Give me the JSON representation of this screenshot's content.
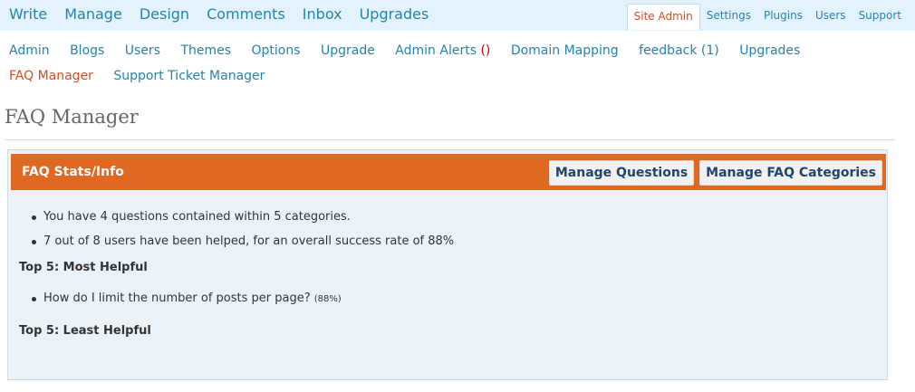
{
  "nav": {
    "primary": [
      "Write",
      "Manage",
      "Design",
      "Comments",
      "Inbox",
      "Upgrades"
    ],
    "secondary": [
      {
        "label": "Site Admin",
        "active": true
      },
      {
        "label": "Settings",
        "active": false
      },
      {
        "label": "Plugins",
        "active": false
      },
      {
        "label": "Users",
        "active": false
      },
      {
        "label": "Support",
        "active": false
      }
    ]
  },
  "subnav": {
    "items": [
      "Admin",
      "Blogs",
      "Users",
      "Themes",
      "Options",
      "Upgrade"
    ],
    "admin_alerts_label": "Admin Alerts",
    "admin_alerts_count": "()",
    "items_after": [
      "Domain Mapping",
      "feedback (1)",
      "Upgrades"
    ],
    "current": "FAQ Manager",
    "last": "Support Ticket Manager"
  },
  "page": {
    "title": "FAQ Manager"
  },
  "panel": {
    "title": "FAQ Stats/Info",
    "buttons": {
      "manage_questions": "Manage Questions",
      "manage_categories": "Manage FAQ Categories"
    },
    "stats": [
      "You have 4 questions contained within 5 categories.",
      "7 out of 8 users have been helped, for an overall success rate of 88%"
    ],
    "most_helpful": {
      "heading": "Top 5: Most Helpful",
      "items": [
        {
          "question": "How do I limit the number of posts per page?",
          "pct": "(88%)"
        }
      ]
    },
    "least_helpful": {
      "heading": "Top 5: Least Helpful"
    }
  },
  "colors": {
    "accent_blue": "#2583ad",
    "accent_orange": "#e06821",
    "current_link": "#d54e21",
    "topbar_bg": "#e4f2fd",
    "panel_bg": "#eaf3fa"
  }
}
